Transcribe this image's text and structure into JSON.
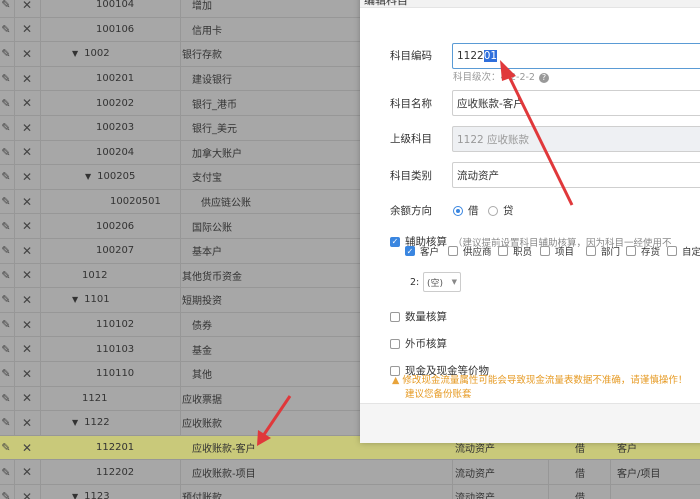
{
  "dialog": {
    "title": "编辑科目",
    "code_label": "科目编码",
    "code_value_plain": "1122",
    "code_value_selected": "01",
    "level_hint": "科目级次：4-2-2-2",
    "name_label": "科目名称",
    "name_value": "应收账款-客户",
    "parent_label": "上级科目",
    "parent_value": "1122 应收账款",
    "category_label": "科目类别",
    "category_value": "流动资产",
    "direction_label": "余额方向",
    "direction_debit": "借",
    "direction_credit": "贷",
    "aux_label": "辅助核算",
    "aux_note": "（建议提前设置科目辅助核算，因为科目一经使用不",
    "aux_options": [
      "客户",
      "供应商",
      "职员",
      "项目",
      "部门",
      "存货",
      "自定义项"
    ],
    "aux_level_label": "2:",
    "aux_level_value": "(空)",
    "qty_label": "数量核算",
    "fx_label": "外币核算",
    "cash_label": "现金及现金等价物",
    "warning": "修改现金流量属性可能会导致现金流量表数据不准确，请谨慎操作！",
    "warning2": "建议您备份账套"
  },
  "rows": [
    {
      "code": "100104",
      "name": "增加",
      "indent": 1,
      "caret": false
    },
    {
      "code": "100106",
      "name": "信用卡",
      "indent": 1,
      "caret": false
    },
    {
      "code": "1002",
      "name": "银行存款",
      "indent": 0,
      "caret": true
    },
    {
      "code": "100201",
      "name": "建设银行",
      "indent": 1,
      "caret": false
    },
    {
      "code": "100202",
      "name": "银行_港币",
      "indent": 1,
      "caret": false
    },
    {
      "code": "100203",
      "name": "银行_美元",
      "indent": 1,
      "caret": false
    },
    {
      "code": "100204",
      "name": "加拿大账户",
      "indent": 1,
      "caret": false
    },
    {
      "code": "100205",
      "name": "支付宝",
      "indent": 1,
      "caret": true
    },
    {
      "code": "10020501",
      "name": "供应链公账",
      "indent": 2,
      "caret": false
    },
    {
      "code": "100206",
      "name": "国际公账",
      "indent": 1,
      "caret": false
    },
    {
      "code": "100207",
      "name": "基本户",
      "indent": 1,
      "caret": false
    },
    {
      "code": "1012",
      "name": "其他货币资金",
      "indent": 0,
      "caret": false
    },
    {
      "code": "1101",
      "name": "短期投资",
      "indent": 0,
      "caret": true
    },
    {
      "code": "110102",
      "name": "债券",
      "indent": 1,
      "caret": false
    },
    {
      "code": "110103",
      "name": "基金",
      "indent": 1,
      "caret": false
    },
    {
      "code": "110110",
      "name": "其他",
      "indent": 1,
      "caret": false
    },
    {
      "code": "1121",
      "name": "应收票据",
      "indent": 0,
      "caret": false
    },
    {
      "code": "1122",
      "name": "应收账款",
      "indent": 0,
      "caret": true
    },
    {
      "code": "112201",
      "name": "应收账款-客户",
      "indent": 1,
      "caret": false,
      "selected": true,
      "type": "流动资产",
      "dir": "借",
      "aux": "客户"
    },
    {
      "code": "112202",
      "name": "应收账款-项目",
      "indent": 1,
      "caret": false,
      "type": "流动资产",
      "dir": "借",
      "aux": "客户/项目"
    },
    {
      "code": "1123",
      "name": "预付账款",
      "indent": 0,
      "caret": true,
      "type": "流动资产",
      "dir": "借",
      "aux": ""
    }
  ],
  "icons": {
    "edit": "pencil-icon",
    "delete": "close-icon",
    "expand": "caret-down-icon",
    "warning": "warning-icon",
    "help": "question-icon"
  },
  "colors": {
    "accent": "#3a86e0",
    "selected_row": "#c9c97a",
    "annotation_arrow": "#e0383b",
    "warning": "#e69a23"
  }
}
